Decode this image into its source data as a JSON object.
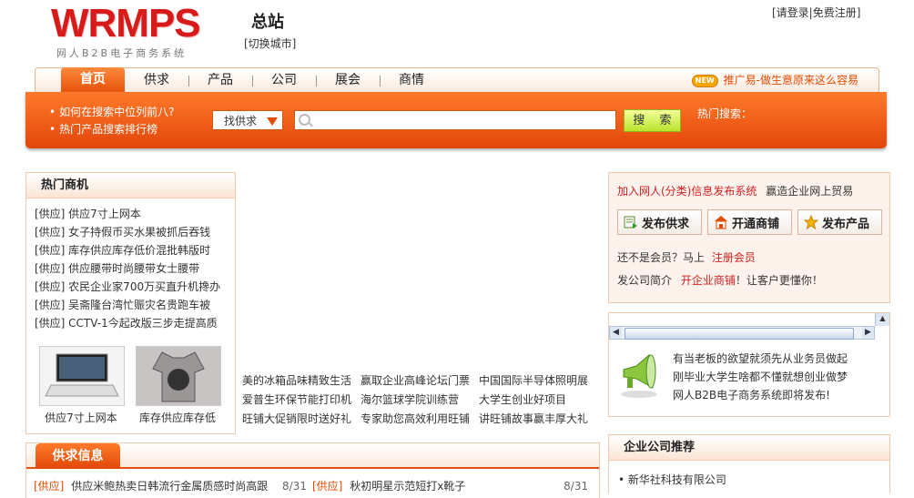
{
  "header": {
    "logo_main": "WRMPS",
    "logo_sub": "网人B2B电子商务系统",
    "site_title": "总站",
    "switch_city": "[切换城市]",
    "top_links": "[请登录|免费注册]"
  },
  "nav": {
    "items": [
      {
        "label": "首页",
        "active": true
      },
      {
        "label": "供求"
      },
      {
        "label": "产品"
      },
      {
        "label": "公司"
      },
      {
        "label": "展会"
      },
      {
        "label": "商情"
      }
    ],
    "promo_badge": "NEW",
    "promo_text": "推广易-做生意原来这么容易"
  },
  "search": {
    "tips": [
      "如何在搜索中位列前八?",
      "热门产品搜索排行榜"
    ],
    "type_selected": "找供求",
    "input_value": "",
    "button_label": "搜 索",
    "hot_label": "热门搜索："
  },
  "hot": {
    "title": "热门商机",
    "items": [
      "[供应] 供应7寸上网本",
      "[供应] 女子持假币买水果被抓后吞钱",
      "[供应] 库存供应库存低价混批韩版时",
      "[供应] 供应腰带时尚腰带女士腰带",
      "[供应] 农民企业家700万买直升机搀办",
      "[供应] 吴斋隆台湾忙赈灾名贵跑车被",
      "[供应] CCTV-1今起改版三步走提高质"
    ],
    "thumbs": [
      {
        "caption": "供应7寸上网本"
      },
      {
        "caption": "库存供应库存低"
      }
    ]
  },
  "mid_links": [
    [
      "美的冰箱品味精致生活",
      "赢取企业高峰论坛门票",
      "中国国际半导体照明展"
    ],
    [
      "爱普生环保节能打印机",
      "海尔篮球学院训练营",
      "大学生创业好项目"
    ],
    [
      "旺铺大促销限时送好礼",
      "专家助您高效利用旺铺",
      "讲旺铺故事赢丰厚大礼"
    ]
  ],
  "join": {
    "link": "加入网人(分类)信息发布系统",
    "slogan": "赢造企业网上贸易",
    "buttons": [
      "发布供求",
      "开通商铺",
      "发布产品"
    ],
    "member_prefix": "还不是会员？马上",
    "member_link": "注册会员",
    "shop_prefix": "发公司简介",
    "shop_link": "开企业商铺",
    "shop_suffix": "！让客户更懂你！"
  },
  "notice": {
    "lines": [
      "有当老板的欲望就须先从业务员做起",
      "刚毕业大学生啥都不懂就想创业做梦",
      "网人B2B电子商务系统即将发布!"
    ]
  },
  "company": {
    "title": "企业公司推荐",
    "items": [
      "• 新华社科技有限公司"
    ]
  },
  "supply": {
    "title": "供求信息",
    "rows": [
      {
        "tag": "[供应]",
        "text": "供应米鲍热卖日韩流行金属质感时尚高跟",
        "date": "8/31"
      },
      {
        "tag": "[供应]",
        "text": "秋初明星示范短打x靴子",
        "date": "8/31"
      }
    ]
  },
  "colors": {
    "brand_red": "#d71a1a",
    "accent_orange": "#e2460a",
    "search_button": "#b9e42c"
  }
}
